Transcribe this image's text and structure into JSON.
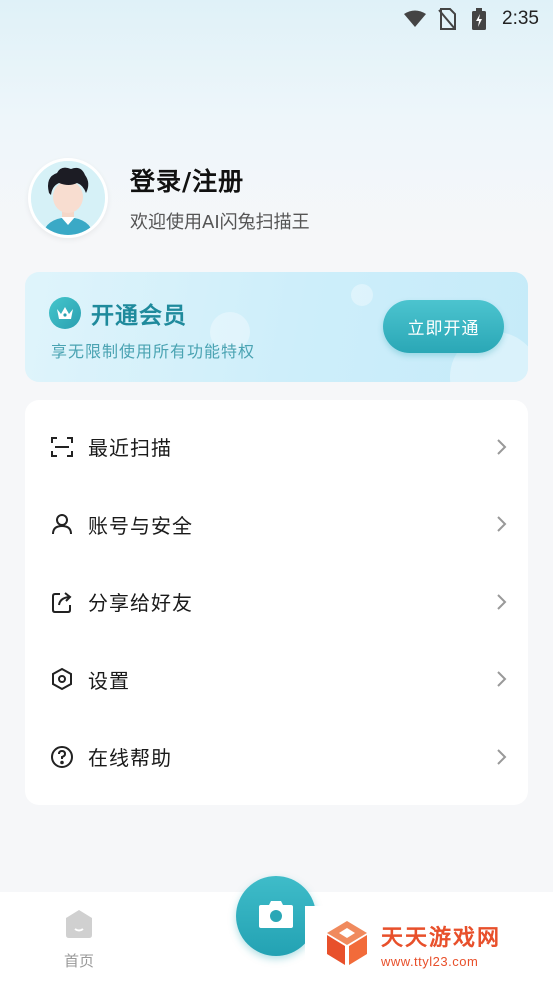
{
  "status_bar": {
    "time": "2:35",
    "icons": [
      "wifi-icon",
      "no-sim-icon",
      "battery-charging-icon"
    ]
  },
  "profile": {
    "title": "登录/注册",
    "subtitle": "欢迎使用AI闪兔扫描王"
  },
  "vip": {
    "title": "开通会员",
    "subtitle": "享无限制使用所有功能特权",
    "button": "立即开通",
    "accent": "#2aa7b6"
  },
  "menu": {
    "items": [
      {
        "label": "最近扫描",
        "icon": "scan-icon"
      },
      {
        "label": "账号与安全",
        "icon": "user-icon"
      },
      {
        "label": "分享给好友",
        "icon": "share-icon"
      },
      {
        "label": "设置",
        "icon": "settings-hexagon-icon"
      },
      {
        "label": "在线帮助",
        "icon": "help-icon"
      }
    ]
  },
  "tabbar": {
    "home_label": "首页",
    "camera_icon": "camera-icon"
  },
  "watermark": {
    "title": "天天游戏网",
    "url": "www.ttyl23.com"
  }
}
